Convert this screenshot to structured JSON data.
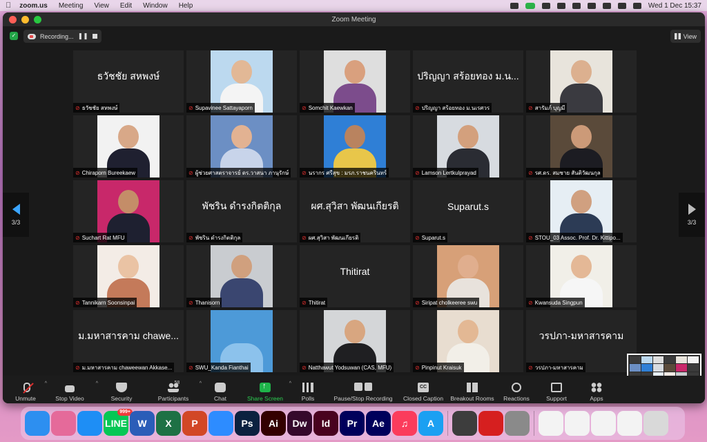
{
  "menubar": {
    "app": "zoom.us",
    "items": [
      "Meeting",
      "View",
      "Edit",
      "Window",
      "Help"
    ],
    "clock": "Wed 1 Dec  15:37"
  },
  "window": {
    "title": "Zoom Meeting",
    "recording_label": "Recording...",
    "view_label": "View",
    "page_indicator": "3/3"
  },
  "tiles": [
    {
      "name": "ธวัชชัย สหพงษ์",
      "big": "ธวัชชัย สหพงษ์",
      "photo": false
    },
    {
      "name": "Supavinee Sattayaporn",
      "photo": true,
      "bg": "#bcd9ef",
      "skin": "#e2b896",
      "cloth": "#f4f4f4"
    },
    {
      "name": "Somchit Kaewkan",
      "photo": true,
      "bg": "#dedede",
      "skin": "#d9a07e",
      "cloth": "#7c4c8c"
    },
    {
      "name": "ปริญญา สร้อยทอง ม.นเรศวร",
      "big": "ปริญญา สร้อยทอง ม.น...",
      "photo": false
    },
    {
      "name": "สารัมภ์ บุญมี",
      "photo": true,
      "bg": "#e8e4dc",
      "skin": "#dcb08f",
      "cloth": "#3a3a40"
    },
    {
      "name": "Chiraporn Bureekaew",
      "photo": true,
      "bg": "#f2f2f2",
      "skin": "#d8a888",
      "cloth": "#1f2030"
    },
    {
      "name": "ผู้ช่วยศาสตราจารย์ ดร.วาสนา ภานุรักษ์",
      "photo": true,
      "bg": "#6c8fc4",
      "skin": "#e2b292",
      "cloth": "#c8d4ea"
    },
    {
      "name": "นรากร ศรีสุข : มรภ.ราชนครินทร์",
      "photo": true,
      "bg": "#2f7fd6",
      "skin": "#b9835f",
      "cloth": "#e8c64a"
    },
    {
      "name": "Lamson Lertkulprayad",
      "photo": true,
      "bg": "#d7dbe0",
      "skin": "#d3a07d",
      "cloth": "#2a2c33"
    },
    {
      "name": "รศ.ดร. สมชาย สันติวัฒนกุล",
      "photo": true,
      "bg": "#5a4a3a",
      "skin": "#cc9a78",
      "cloth": "#1c1c22"
    },
    {
      "name": "Suchart Rat MFU",
      "photo": true,
      "bg": "#c8286a",
      "skin": "#c48d68",
      "cloth": "#1e2030"
    },
    {
      "name": "พัชริน ดำรงกิตติกุล",
      "big": "พัชริน ดำรงกิตติกุล",
      "photo": false
    },
    {
      "name": "ผศ.สุวิสา พัฒนเกียรติ",
      "big": "ผศ.สุวิสา พัฒนเกียรติ",
      "photo": false
    },
    {
      "name": "Suparut.s",
      "big": "Suparut.s",
      "photo": false
    },
    {
      "name": "STOU_03 Assoc. Prof. Dr. Kittipo...",
      "photo": true,
      "bg": "#e6eef4",
      "skin": "#d0a080",
      "cloth": "#2c3b55"
    },
    {
      "name": "Tannikarn Soonsinpai",
      "photo": true,
      "bg": "#f3ece6",
      "skin": "#eac3a4",
      "cloth": "#c47a5a"
    },
    {
      "name": "Thanisorn",
      "photo": true,
      "bg": "#c9ccd0",
      "skin": "#d0a07e",
      "cloth": "#3a4670"
    },
    {
      "name": "Thitirat",
      "big": "Thitirat",
      "photo": false
    },
    {
      "name": "Siripat cholkeeree swu",
      "photo": true,
      "bg": "#d7a078",
      "skin": "#e0ae8e",
      "cloth": "#e8e2dc"
    },
    {
      "name": "Kwansuda Singpun",
      "photo": true,
      "bg": "#f1efe8",
      "skin": "#e4b896",
      "cloth": "#f6f6f6"
    },
    {
      "name": "ม.มหาสารคาม chaweewan Akkase...",
      "big": "ม.มหาสารคาม chawe...",
      "photo": false
    },
    {
      "name": "SWU_Kanda Fianthai",
      "photo": true,
      "bg": "#4d9ad8",
      "skin": "#4d9ad8",
      "cloth": "#8cc2ec"
    },
    {
      "name": "Natthawut Yodsuwan (CAS, MFU)",
      "photo": true,
      "bg": "#d4d6d8",
      "skin": "#d8a680",
      "cloth": "#1f1f22"
    },
    {
      "name": "Pinpinut Kraisuk",
      "photo": true,
      "bg": "#e8ddd0",
      "skin": "#e3b894",
      "cloth": "#f2efe8"
    },
    {
      "name": "วรปภา-มหาสารคาม",
      "big": "วรปภา-มหาสารคาม",
      "photo": false
    }
  ],
  "toolbar": {
    "unmute": "Unmute",
    "stop_video": "Stop Video",
    "security": "Security",
    "participants": "Participants",
    "participants_count": "58",
    "chat": "Chat",
    "share_screen": "Share Screen",
    "polls": "Polls",
    "pause_stop_recording": "Pause/Stop Recording",
    "closed_caption": "Closed Caption",
    "closed_caption_icon_text": "CC",
    "breakout_rooms": "Breakout Rooms",
    "reactions": "Reactions",
    "support": "Support",
    "apps": "Apps"
  },
  "dock": {
    "line_badge": "999+",
    "apps": [
      {
        "id": "finder",
        "label": "",
        "color": "#2d8ff0"
      },
      {
        "id": "launchpad",
        "label": "",
        "color": "#e56a9a"
      },
      {
        "id": "safari",
        "label": "",
        "color": "#1e8ef5"
      },
      {
        "id": "line",
        "label": "LINE",
        "color": "#06c755"
      },
      {
        "id": "word",
        "label": "W",
        "color": "#2b5db8"
      },
      {
        "id": "excel",
        "label": "X",
        "color": "#1e7145"
      },
      {
        "id": "powerpoint",
        "label": "P",
        "color": "#d24726"
      },
      {
        "id": "zoom",
        "label": "",
        "color": "#2d8cff"
      },
      {
        "id": "photoshop",
        "label": "Ps",
        "color": "#0b2140"
      },
      {
        "id": "illustrator",
        "label": "Ai",
        "color": "#330000"
      },
      {
        "id": "dreamweaver",
        "label": "Dw",
        "color": "#35092c"
      },
      {
        "id": "indesign",
        "label": "Id",
        "color": "#49021f"
      },
      {
        "id": "premiere",
        "label": "Pr",
        "color": "#00005b"
      },
      {
        "id": "aftereffects",
        "label": "Ae",
        "color": "#00005b"
      },
      {
        "id": "music",
        "label": "♫",
        "color": "#fb3c5c"
      },
      {
        "id": "appstore",
        "label": "A",
        "color": "#1ba0f2"
      },
      {
        "id": "quicktime",
        "label": "",
        "color": "#3d3d3d"
      },
      {
        "id": "acrobat",
        "label": "",
        "color": "#d61f1f"
      },
      {
        "id": "preferences",
        "label": "",
        "color": "#8a8a8a"
      },
      {
        "id": "doc1",
        "label": "",
        "color": "#f3f3f3"
      },
      {
        "id": "doc2",
        "label": "",
        "color": "#f3f3f3"
      },
      {
        "id": "doc3",
        "label": "",
        "color": "#f3f3f3"
      },
      {
        "id": "doc4",
        "label": "",
        "color": "#f3f3f3"
      },
      {
        "id": "trash",
        "label": "",
        "color": "#d9d9d9"
      }
    ]
  },
  "colors": {
    "zoom_bg": "#1a1a1a",
    "tile_bg": "#242424",
    "share_green": "#2cd052",
    "mute_red": "#e0302f",
    "nav_blue": "#3ba5ff"
  }
}
